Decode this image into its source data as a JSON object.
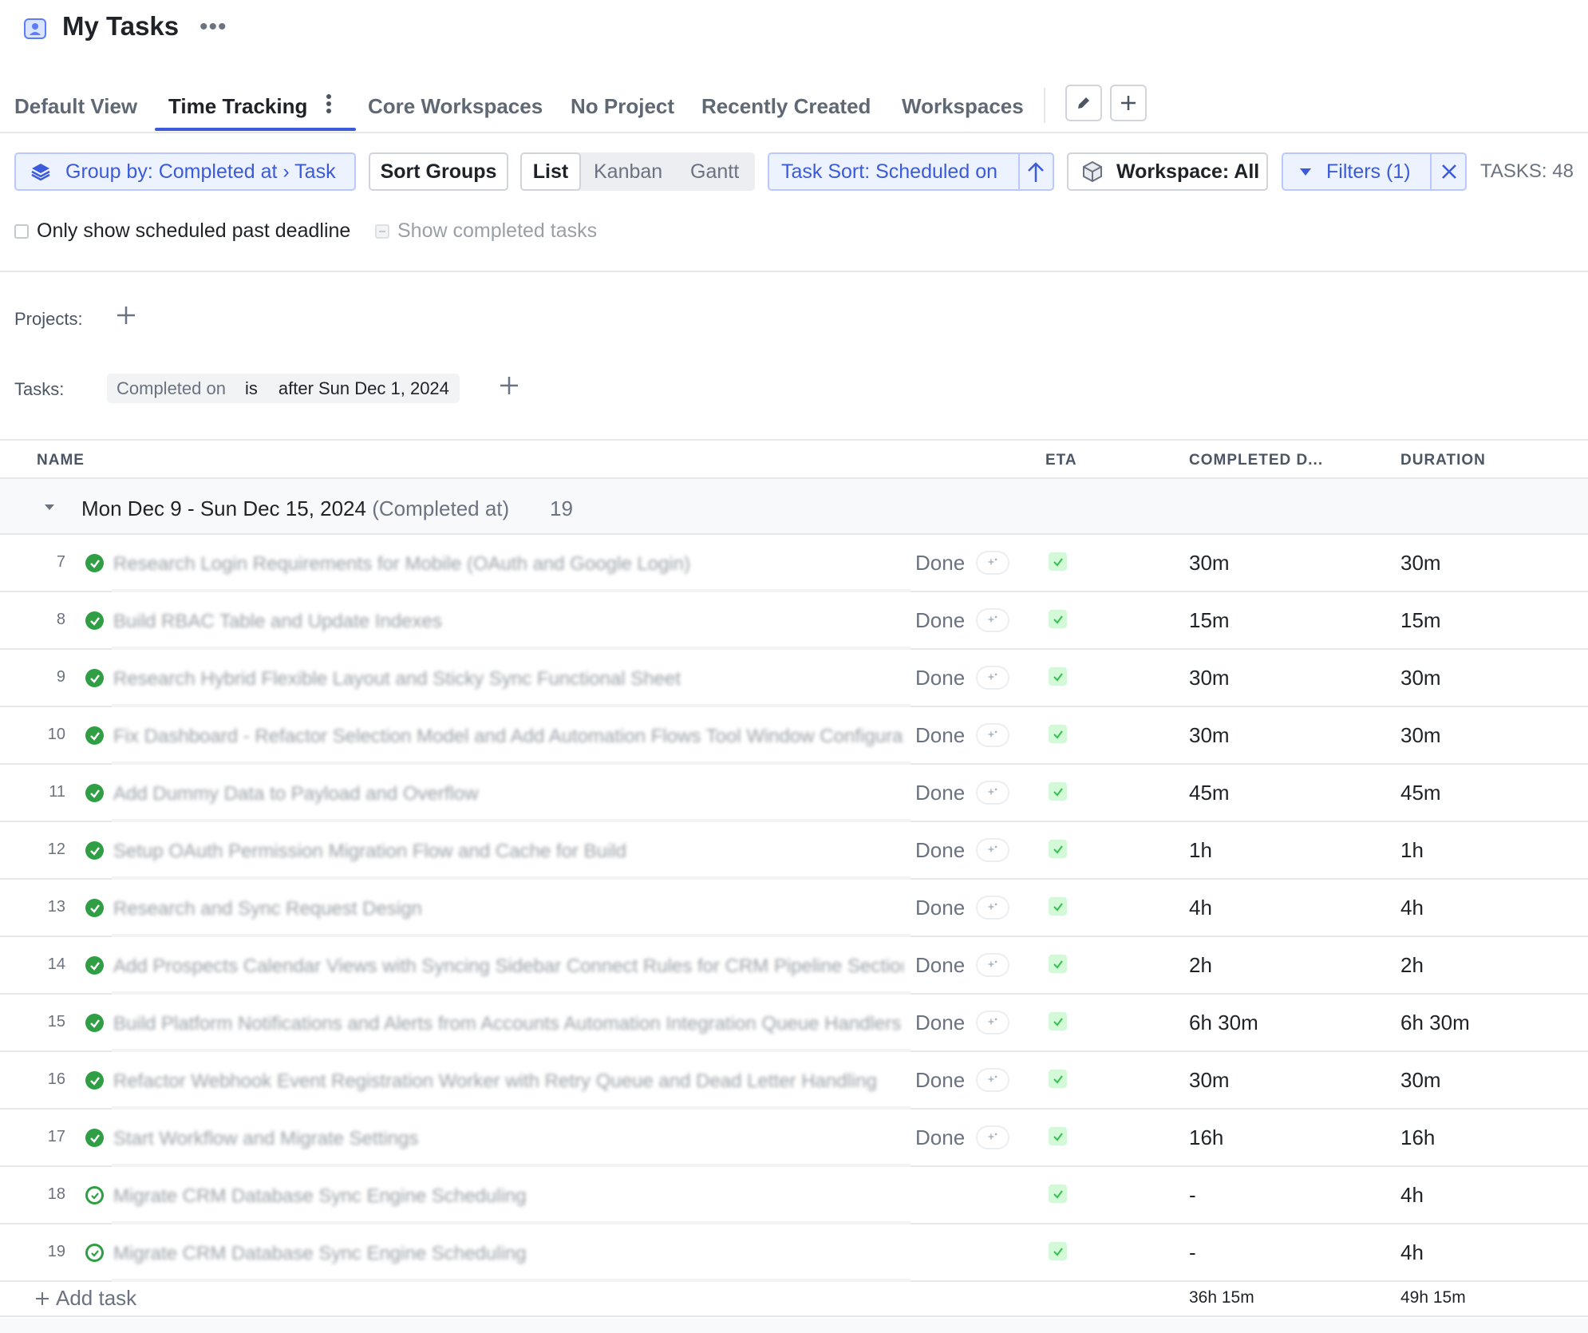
{
  "header": {
    "title": "My Tasks",
    "more": "•••"
  },
  "tabs": [
    {
      "label": "Default View",
      "active": false
    },
    {
      "label": "Time Tracking",
      "active": true
    },
    {
      "label": "Core Workspaces",
      "active": false
    },
    {
      "label": "No Project",
      "active": false
    },
    {
      "label": "Recently Created",
      "active": false
    },
    {
      "label": "Workspaces",
      "active": false
    }
  ],
  "toolbar": {
    "group_by": "Group by: Completed at › Task",
    "sort_groups": "Sort Groups",
    "views": [
      "List",
      "Kanban",
      "Gantt"
    ],
    "selected_view": "List",
    "task_sort": "Task Sort: Scheduled on",
    "workspace": "Workspace: All",
    "filters": "Filters (1)",
    "tasks_count": "TASKS: 48"
  },
  "options": {
    "past_deadline": "Only show scheduled past deadline",
    "show_completed": "Show completed tasks"
  },
  "filters": {
    "projects_label": "Projects:",
    "tasks_label": "Tasks:",
    "chip": {
      "field": "Completed on",
      "op": "is",
      "value": "after Sun Dec 1, 2024"
    }
  },
  "table": {
    "columns": {
      "name": "NAME",
      "eta": "ETA",
      "completed": "COMPLETED D...",
      "duration": "DURATION"
    },
    "group": {
      "title": "Mon Dec 9 - Sun Dec 15, 2024",
      "subtitle": "(Completed at)",
      "count": "19"
    },
    "rows": [
      {
        "num": "7",
        "name": "Research Login Requirements for Mobile (OAuth and Google Login)",
        "status": "Done",
        "completed": "30m",
        "duration": "30m",
        "done": true
      },
      {
        "num": "8",
        "name": "Build RBAC Table and Update Indexes",
        "status": "Done",
        "completed": "15m",
        "duration": "15m",
        "done": true
      },
      {
        "num": "9",
        "name": "Research Hybrid Flexible Layout and Sticky Sync Functional Sheet",
        "status": "Done",
        "completed": "30m",
        "duration": "30m",
        "done": true
      },
      {
        "num": "10",
        "name": "Fix Dashboard - Refactor Selection Model and Add Automation Flows Tool Window Configuration",
        "status": "Done",
        "completed": "30m",
        "duration": "30m",
        "done": true
      },
      {
        "num": "11",
        "name": "Add Dummy Data to Payload and Overflow",
        "status": "Done",
        "completed": "45m",
        "duration": "45m",
        "done": true
      },
      {
        "num": "12",
        "name": "Setup OAuth Permission Migration Flow and Cache for Build",
        "status": "Done",
        "completed": "1h",
        "duration": "1h",
        "done": true
      },
      {
        "num": "13",
        "name": "Research and Sync Request Design",
        "status": "Done",
        "completed": "4h",
        "duration": "4h",
        "done": true
      },
      {
        "num": "14",
        "name": "Add Prospects Calendar Views with Syncing Sidebar Connect Rules for CRM Pipeline Sections",
        "status": "Done",
        "completed": "2h",
        "duration": "2h",
        "done": true
      },
      {
        "num": "15",
        "name": "Build Platform Notifications and Alerts from Accounts Automation Integration Queue Handlers",
        "status": "Done",
        "completed": "6h 30m",
        "duration": "6h 30m",
        "done": true
      },
      {
        "num": "16",
        "name": "Refactor Webhook Event Registration Worker with Retry Queue and Dead Letter Handling",
        "status": "Done",
        "completed": "30m",
        "duration": "30m",
        "done": true
      },
      {
        "num": "17",
        "name": "Start Workflow and Migrate Settings",
        "status": "Done",
        "completed": "16h",
        "duration": "16h",
        "done": true
      },
      {
        "num": "18",
        "name": "Migrate CRM Database Sync Engine Scheduling",
        "status": "",
        "completed": "-",
        "duration": "4h",
        "done": false
      },
      {
        "num": "19",
        "name": "Migrate CRM Database Sync Engine Scheduling",
        "status": "",
        "completed": "-",
        "duration": "4h",
        "done": false
      }
    ],
    "add_task": "Add task",
    "total_completed": "36h 15m",
    "total_duration": "49h 15m"
  },
  "colors": {
    "accent": "#3b5bdb",
    "done_green": "#2f9e44",
    "eta_bg": "#d3f9d8"
  },
  "icons": [
    "app-icon",
    "more-icon",
    "kebab-icon",
    "edit-icon",
    "plus-icon",
    "layers-icon",
    "arrow-up-icon",
    "cube-icon",
    "triangle-down-icon",
    "close-icon",
    "caret-down-icon",
    "check-circle-icon",
    "sparkle-icon",
    "check-icon"
  ]
}
